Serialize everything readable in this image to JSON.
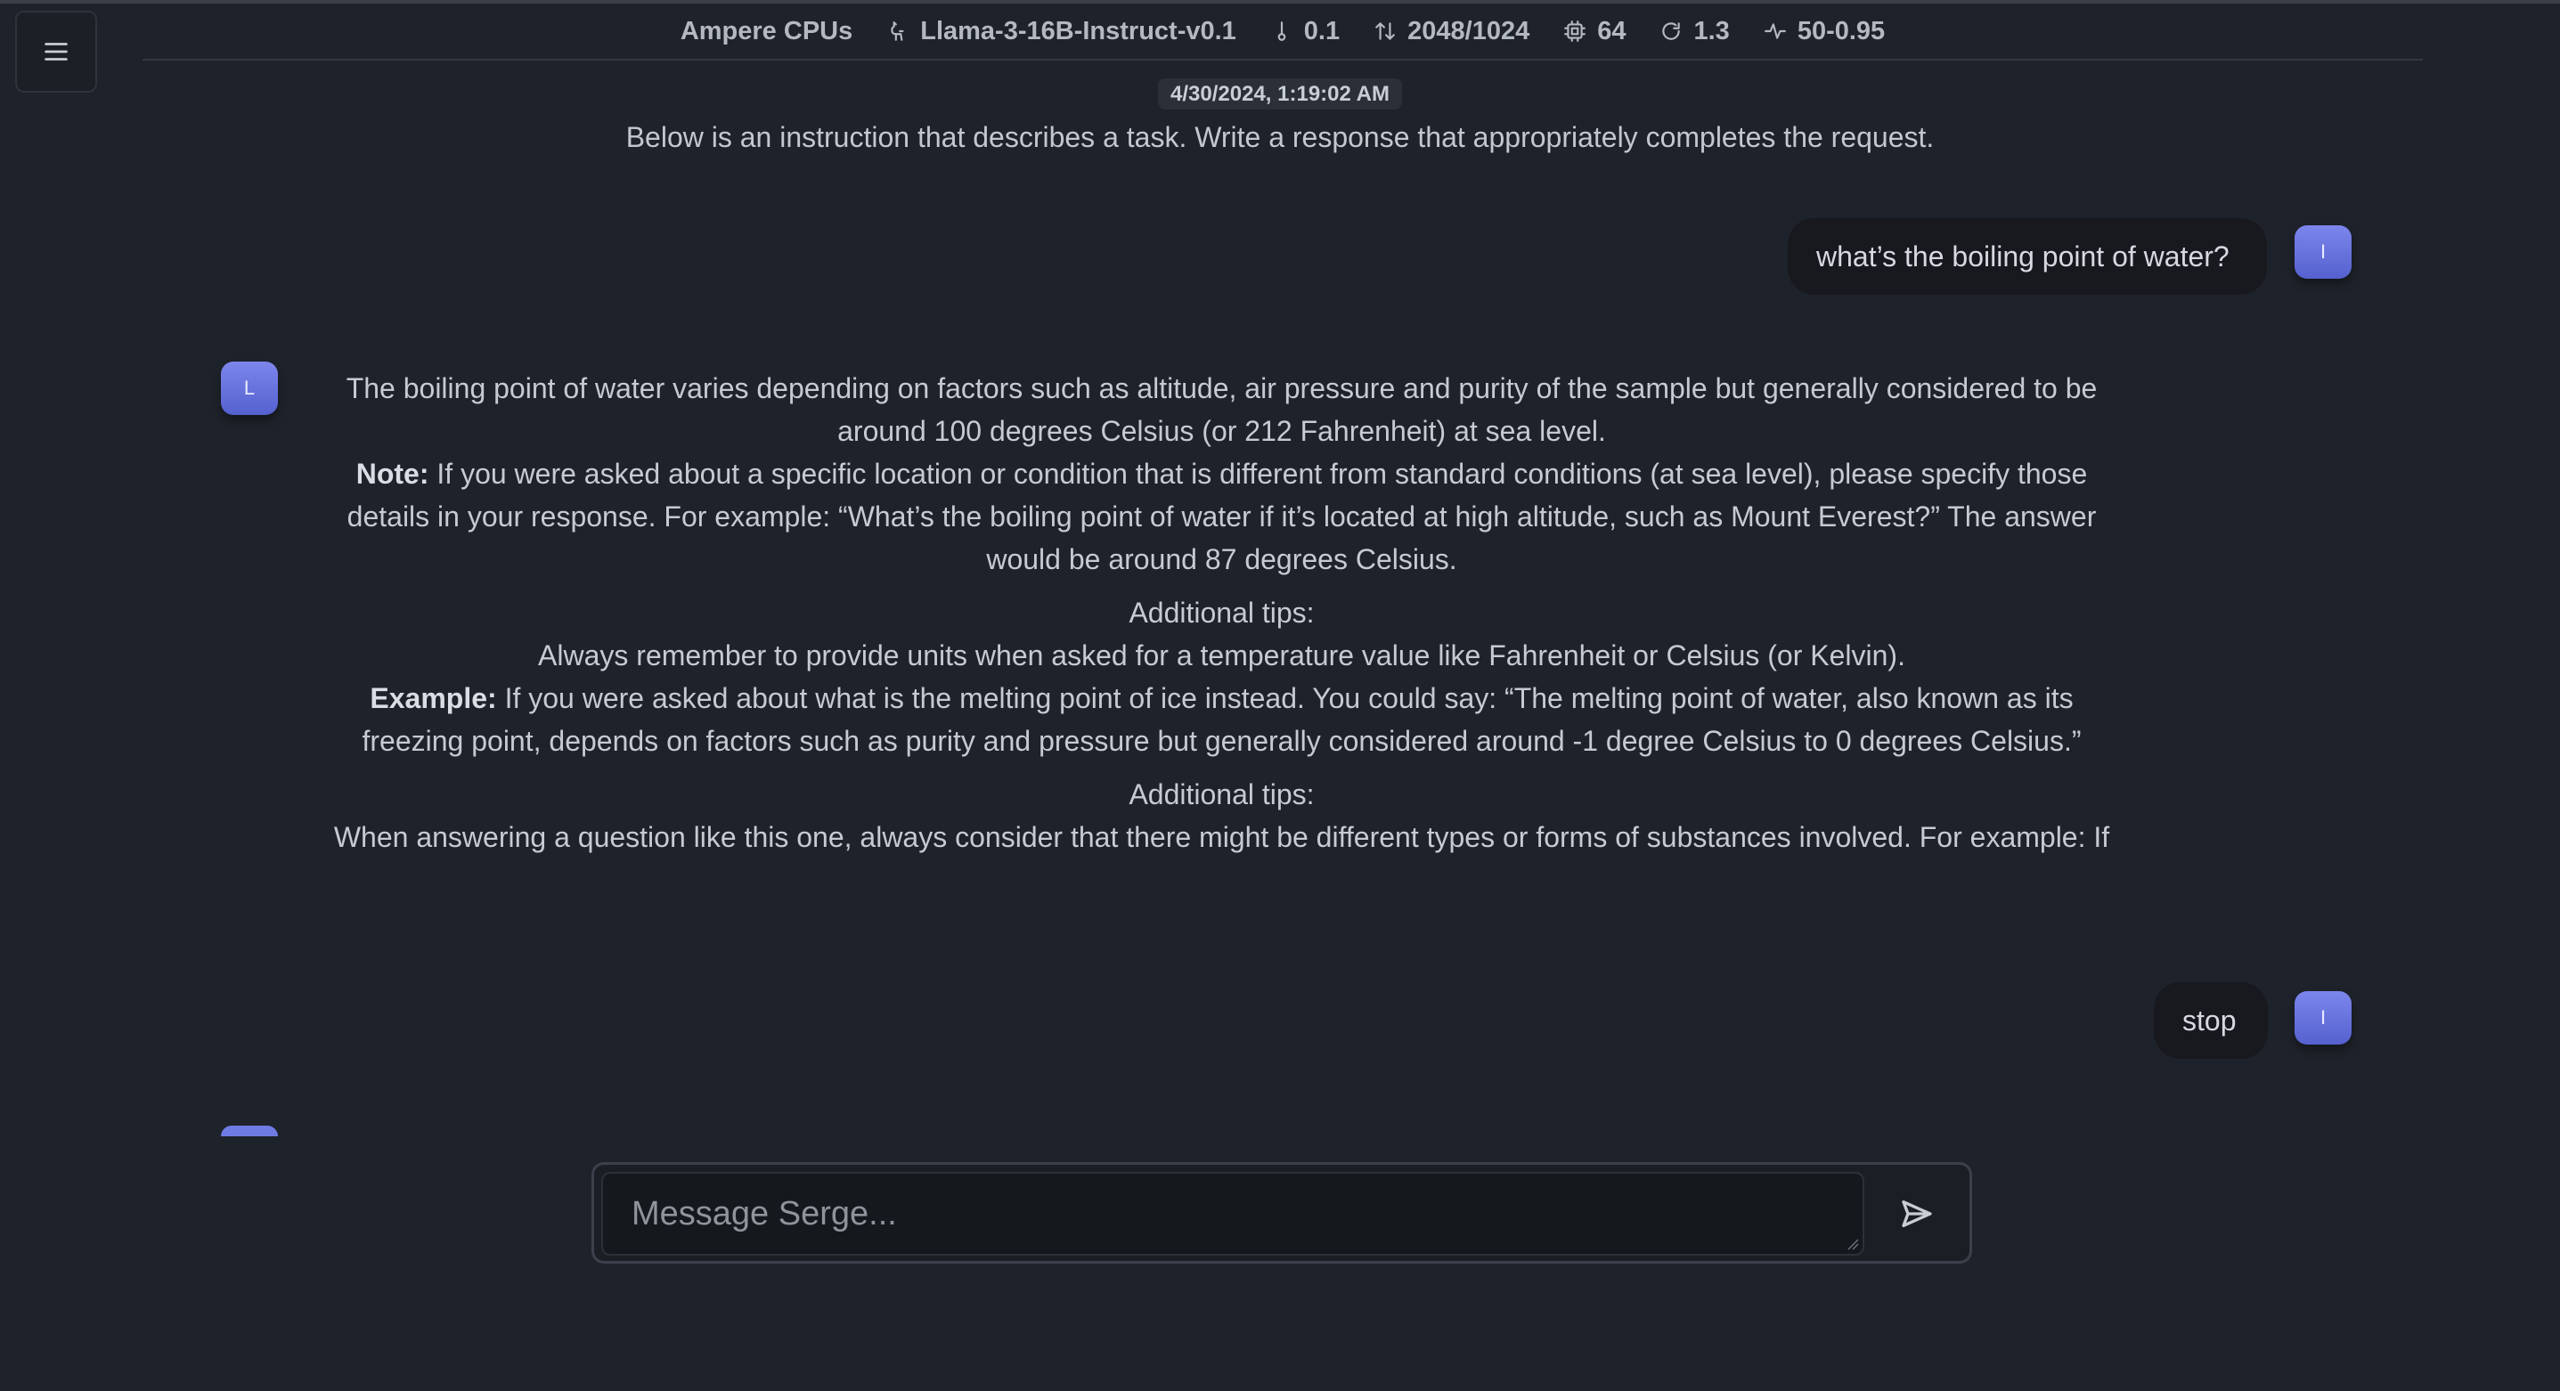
{
  "header": {
    "backend": "Ampere CPUs",
    "model": "Llama-3-16B-Instruct-v0.1",
    "temperature": "0.1",
    "context": "2048/1024",
    "threads": "64",
    "repeat_penalty": "1.3",
    "top": "50-0.95"
  },
  "chat": {
    "date": "4/30/2024, 1:19:02 AM",
    "system_prompt": "Below is an instruction that describes a task. Write a response that appropriately completes the request.",
    "user_initial": "I",
    "assistant_initial": "L",
    "messages": [
      {
        "role": "user",
        "text": "what’s the boiling point of water?"
      },
      {
        "role": "assistant",
        "p1": "The boiling point of water varies depending on factors such as altitude, air pressure and purity of the sample but generally considered to be around 100 degrees Celsius (or 212 Fahrenheit) at sea level.",
        "note_label": "Note:",
        "note_text": " If you were asked about a specific location or condition that is different from standard conditions (at sea level), please specify those details in your response. For example: “What’s the boiling point of water if it’s located at high altitude, such as Mount Everest?” The answer would be around 87 degrees Celsius.",
        "tips1_heading": "Additional tips:",
        "tips1_text": "Always remember to provide units when asked for a temperature value like Fahrenheit or Celsius (or Kelvin).",
        "example_label": "Example:",
        "example_text": " If you were asked about what is the melting point of ice instead. You could say: “The melting point of water, also known as its freezing point, depends on factors such as purity and pressure but generally considered around -1 degree Celsius to 0 degrees Celsius.”",
        "tips2_heading": "Additional tips:",
        "tips2_text": "When answering a question like this one, always consider that there might be different types or forms of substances involved. For example: If"
      },
      {
        "role": "user",
        "text": "stop"
      }
    ]
  },
  "input": {
    "placeholder": "Message Serge..."
  },
  "icons": {
    "menu": "hamburger-icon",
    "model": "llama-icon",
    "temperature": "thermometer-icon",
    "context": "arrows-up-down-icon",
    "threads": "cpu-icon",
    "repeat_penalty": "refresh-icon",
    "top": "activity-icon",
    "send": "send-icon"
  },
  "colors": {
    "background": "#1e222a",
    "avatar": "#6f7be5",
    "bubble": "#17191f"
  }
}
